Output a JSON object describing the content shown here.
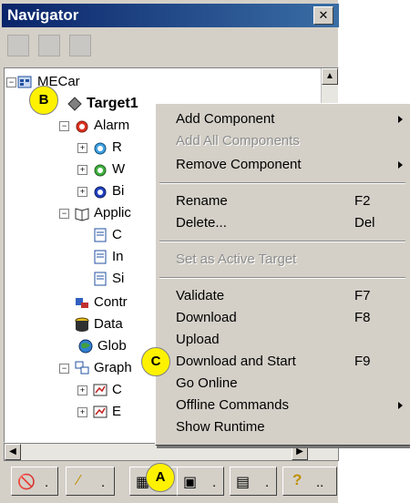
{
  "window": {
    "title": "Navigator"
  },
  "tree": {
    "root": "MECar",
    "target": "Target1",
    "nodes": [
      {
        "label": "Alarm"
      },
      {
        "label": "R"
      },
      {
        "label": "W"
      },
      {
        "label": "Bi"
      },
      {
        "label": "Applic"
      },
      {
        "label": "C"
      },
      {
        "label": "In"
      },
      {
        "label": "Si"
      },
      {
        "label": "Contr"
      },
      {
        "label": "Data"
      },
      {
        "label": "Glob"
      },
      {
        "label": "Graph"
      },
      {
        "label": "C"
      },
      {
        "label": "E"
      }
    ]
  },
  "callouts": {
    "a": "A",
    "b": "B",
    "c": "C"
  },
  "context_menu": {
    "items": [
      {
        "label": "Add Component",
        "shortcut": "",
        "submenu": true,
        "disabled": false
      },
      {
        "label": "Add All Components",
        "shortcut": "",
        "submenu": false,
        "disabled": true
      },
      {
        "label": "Remove Component",
        "shortcut": "",
        "submenu": true,
        "disabled": false
      },
      {
        "label": "Rename",
        "shortcut": "F2",
        "submenu": false,
        "disabled": false
      },
      {
        "label": "Delete...",
        "shortcut": "Del",
        "submenu": false,
        "disabled": false
      },
      {
        "label": "Set as Active Target",
        "shortcut": "",
        "submenu": false,
        "disabled": true
      },
      {
        "label": "Validate",
        "shortcut": "F7",
        "submenu": false,
        "disabled": false
      },
      {
        "label": "Download",
        "shortcut": "F8",
        "submenu": false,
        "disabled": false
      },
      {
        "label": "Upload",
        "shortcut": "",
        "submenu": false,
        "disabled": false
      },
      {
        "label": "Download and Start",
        "shortcut": "F9",
        "submenu": false,
        "disabled": false
      },
      {
        "label": "Go Online",
        "shortcut": "",
        "submenu": false,
        "disabled": false
      },
      {
        "label": "Offline Commands",
        "shortcut": "",
        "submenu": true,
        "disabled": false
      },
      {
        "label": "Show Runtime",
        "shortcut": "",
        "submenu": false,
        "disabled": false
      }
    ]
  },
  "bottom_tabs": {
    "t1": ".",
    "t2": ".",
    "t3": ".",
    "t4": ".",
    "t5": ".",
    "t6": ".."
  },
  "colors": {
    "titlebar": "#0a246a",
    "callout": "#fff200"
  }
}
